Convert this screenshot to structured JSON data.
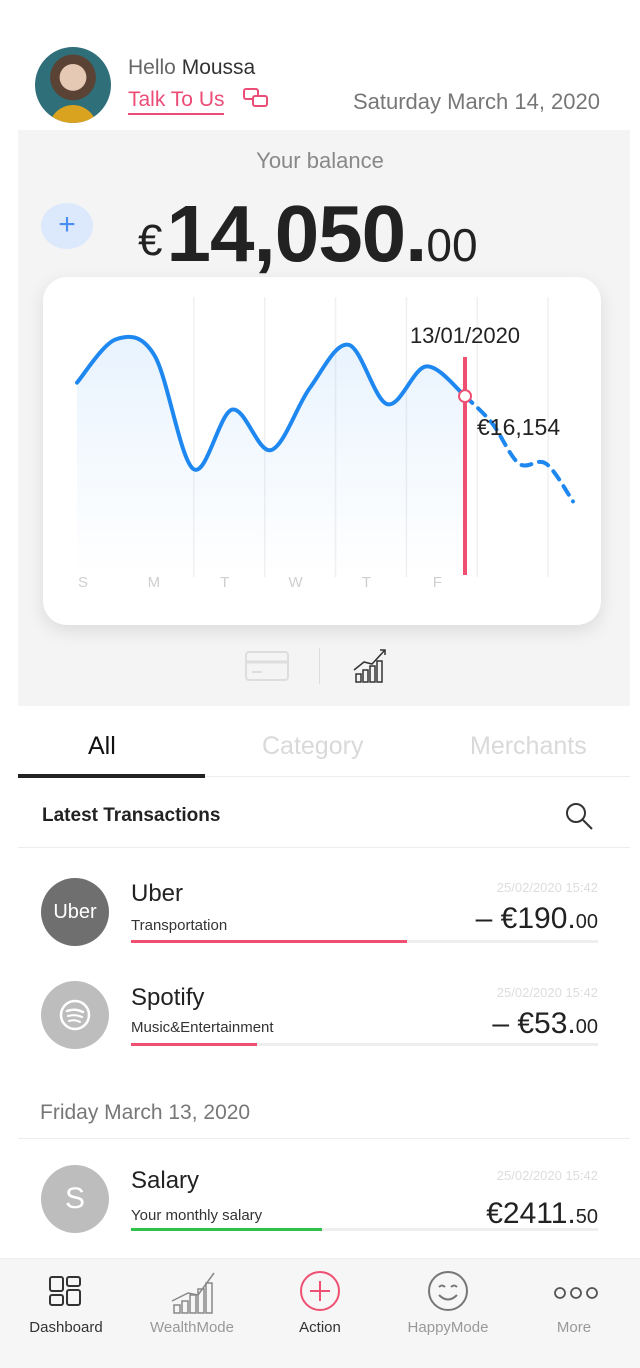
{
  "header": {
    "greeting": "Hello",
    "user_name": "Moussa",
    "talk_link": "Talk To Us",
    "date": "Saturday March 14, 2020"
  },
  "balance": {
    "label": "Your balance",
    "currency": "€",
    "integer": "14,050.",
    "decimal": "00",
    "add_icon": "plus-icon"
  },
  "chart": {
    "marker_date": "13/01/2020",
    "marker_value": "€16,154",
    "days": [
      "S",
      "M",
      "T",
      "W",
      "T",
      "F",
      "",
      ""
    ],
    "line_color": "#1e88f0",
    "marker_color": "#ef4f71"
  },
  "chart_data": {
    "type": "line",
    "categories": [
      "S",
      "M",
      "T",
      "W",
      "T",
      "F",
      "",
      ""
    ],
    "series": [
      {
        "values": [
          0.72,
          0.88,
          0.82,
          0.4,
          0.62,
          0.47,
          0.7,
          0.86,
          0.64,
          0.78,
          0.67
        ]
      },
      {
        "values": [
          0.67,
          0.57,
          0.42,
          0.42,
          0.28
        ]
      }
    ]
  },
  "view_toggle": {
    "card_icon": "card-icon",
    "chart_icon": "chart-growth-icon"
  },
  "tabs": [
    "All",
    "Category",
    "Merchants"
  ],
  "transactions_header": {
    "title": "Latest Transactions",
    "search_icon": "search-icon"
  },
  "transactions": [
    {
      "logo": "Uber",
      "name": "Uber",
      "category": "Transportation",
      "time": "25/02/2020 15:42",
      "amount": "– €190.",
      "cents": "00",
      "bar_color": "#ef4f71",
      "bar_fraction": 0.59
    },
    {
      "logo": "spotify-icon",
      "name": "Spotify",
      "category": "Music&Entertainment",
      "time": "25/02/2020 15:42",
      "amount": "– €53.",
      "cents": "00",
      "bar_color": "#ef4f71",
      "bar_fraction": 0.27
    }
  ],
  "group_date": "Friday March 13, 2020",
  "transactions_2": [
    {
      "logo": "S",
      "name": "Salary",
      "category": "Your monthly salary",
      "time": "25/02/2020 15:42",
      "amount": "€2411.",
      "cents": "50",
      "bar_color": "#2ec24a",
      "bar_fraction": 0.41
    }
  ],
  "nav": [
    {
      "label": "Dashboard",
      "icon": "dashboard-icon"
    },
    {
      "label": "WealthMode",
      "icon": "wealth-chart-icon"
    },
    {
      "label": "Action",
      "icon": "plus-circle-icon"
    },
    {
      "label": "HappyMode",
      "icon": "smiley-icon"
    },
    {
      "label": "More",
      "icon": "more-dots-icon"
    }
  ]
}
